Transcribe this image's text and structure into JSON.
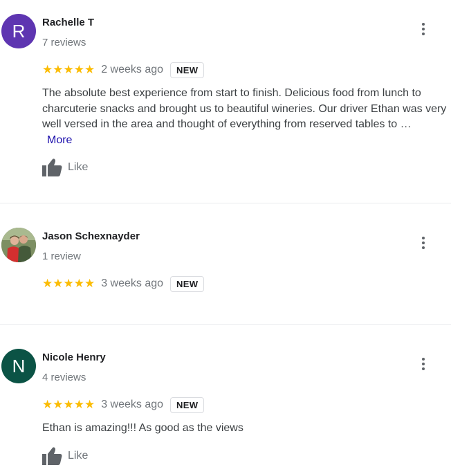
{
  "reviews": [
    {
      "initial": "R",
      "avatar_color": "#5e35b1",
      "name": "Rachelle T",
      "review_count": "7 reviews",
      "stars": "★★★★★",
      "rating": 5,
      "date": "2 weeks ago",
      "badge": "NEW",
      "text": "The absolute best experience from start to finish. Delicious food from lunch to charcuterie snacks and brought us to beautiful wineries. Our driver Ethan was very well versed in the area and thought of everything from reserved tables to …",
      "more_label": "More",
      "like_label": "Like"
    },
    {
      "name": "Jason Schexnayder",
      "review_count": "1 review",
      "stars": "★★★★★",
      "rating": 5,
      "date": "3 weeks ago",
      "badge": "NEW"
    },
    {
      "initial": "N",
      "avatar_color": "#0b5345",
      "name": "Nicole Henry",
      "review_count": "4 reviews",
      "stars": "★★★★★",
      "rating": 5,
      "date": "3 weeks ago",
      "badge": "NEW",
      "text": "Ethan is amazing!!! As good as the views",
      "like_label": "Like"
    }
  ],
  "colors": {
    "star": "#fbbc04",
    "link": "#1a0dab",
    "muted": "#70757a"
  }
}
